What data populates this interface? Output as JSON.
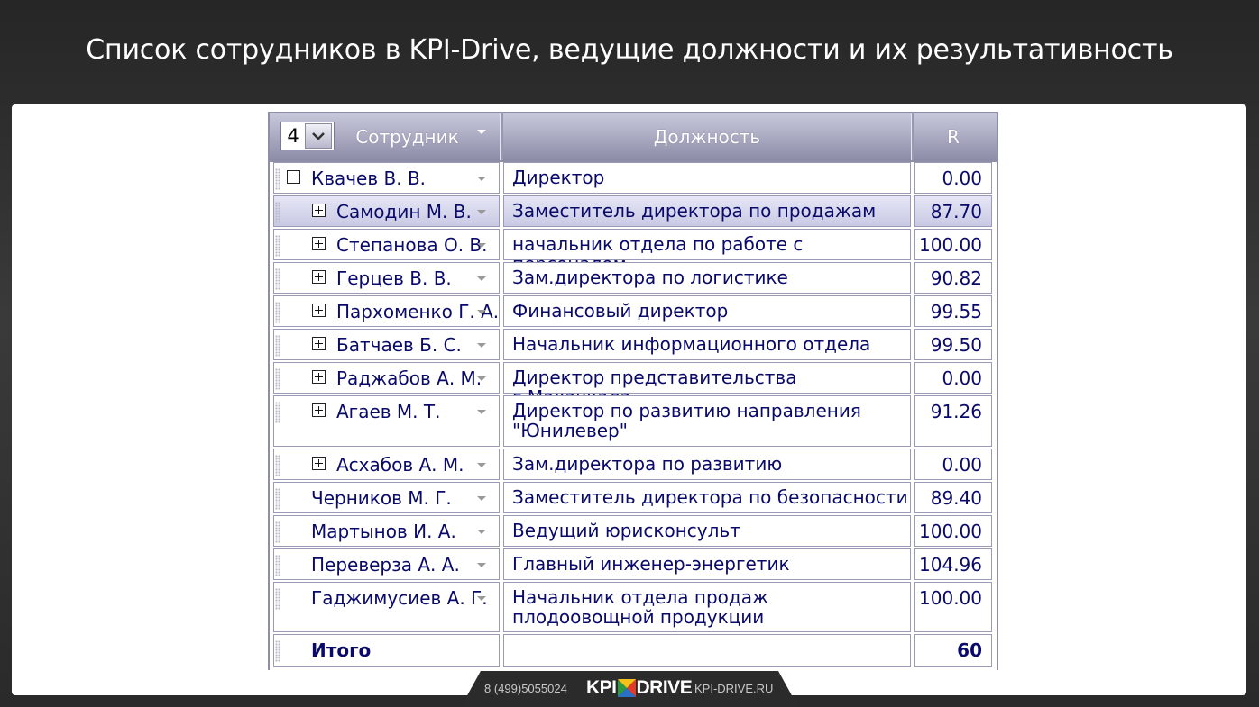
{
  "title": "Список сотрудников в KPI-Drive, ведущие должности и их результативность",
  "grid": {
    "page_select_value": "4",
    "columns": [
      "Сотрудник",
      "Должность",
      "R"
    ],
    "rows": [
      {
        "name": "Квачев В. В.",
        "position": "Директор",
        "r": "0.00",
        "expander": "minus",
        "level": 0
      },
      {
        "name": "Самодин М. В.",
        "position": "Заместитель директора по продажам",
        "r": "87.70",
        "expander": "plus",
        "level": 1,
        "selected": true
      },
      {
        "name": "Степанова О. В.",
        "position": "начальник отдела по работе с персоналом",
        "r": "100.00",
        "expander": "plus",
        "level": 1
      },
      {
        "name": "Герцев В. В.",
        "position": "Зам.директора по логистике",
        "r": "90.82",
        "expander": "plus",
        "level": 1
      },
      {
        "name": "Пархоменко Г. А.",
        "position": "Финансовый директор",
        "r": "99.55",
        "expander": "plus",
        "level": 1
      },
      {
        "name": "Батчаев Б. С.",
        "position": "Начальник информационного отдела",
        "r": "99.50",
        "expander": "plus",
        "level": 1
      },
      {
        "name": "Раджабов А. М.",
        "position": "Директор представительства г.Махачкала",
        "r": "0.00",
        "expander": "plus",
        "level": 1
      },
      {
        "name": "Агаев М. Т.",
        "position": "Директор по развитию направления \"Юнилевер\"",
        "r": "91.26",
        "expander": "plus",
        "level": 1
      },
      {
        "name": "Асхабов А. М.",
        "position": "Зам.директора по развитию",
        "r": "0.00",
        "expander": "plus",
        "level": 1
      },
      {
        "name": "Черников М. Г.",
        "position": "Заместитель директора по безопасности",
        "r": "89.40",
        "expander": "none",
        "level": 1
      },
      {
        "name": "Мартынов И. А.",
        "position": "Ведущий юрисконсульт",
        "r": "100.00",
        "expander": "none",
        "level": 1
      },
      {
        "name": "Переверза А. А.",
        "position": "Главный инженер-энергетик",
        "r": "104.96",
        "expander": "none",
        "level": 1
      },
      {
        "name": "Гаджимусиев А. Г.",
        "position": "Начальник отдела продаж плодоовощной продукции",
        "r": "100.00",
        "expander": "none",
        "level": 1
      }
    ],
    "total_label": "Итого",
    "total_value": "60"
  },
  "footer": {
    "phone": "8 (499)5055024",
    "logo_left": "KPI",
    "logo_right": "DRIVE",
    "site": "KPI-DRIVE.RU"
  },
  "colors": {
    "header_bg": "#8c8ca8",
    "row_text": "#0a0a6a",
    "selected_row": "#c9c9e4"
  }
}
